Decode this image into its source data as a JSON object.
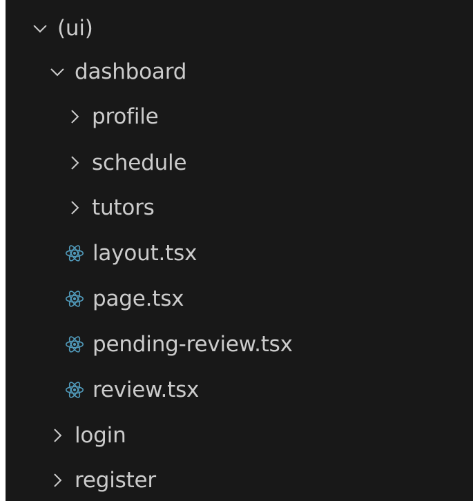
{
  "colors": {
    "background": "#181818",
    "text": "#cccccc",
    "react_icon": "#519aba"
  },
  "tree": {
    "ui": {
      "label": "(ui)",
      "state": "expanded",
      "icon": "chevron-down"
    },
    "dashboard": {
      "label": "dashboard",
      "state": "expanded",
      "icon": "chevron-down"
    },
    "profile": {
      "label": "profile",
      "state": "collapsed",
      "icon": "chevron-right"
    },
    "schedule": {
      "label": "schedule",
      "state": "collapsed",
      "icon": "chevron-right"
    },
    "tutors": {
      "label": "tutors",
      "state": "collapsed",
      "icon": "chevron-right"
    },
    "layout": {
      "label": "layout.tsx",
      "icon": "react-icon"
    },
    "page": {
      "label": "page.tsx",
      "icon": "react-icon"
    },
    "pending_review": {
      "label": "pending-review.tsx",
      "icon": "react-icon"
    },
    "review": {
      "label": "review.tsx",
      "icon": "react-icon"
    },
    "login": {
      "label": "login",
      "state": "collapsed",
      "icon": "chevron-right"
    },
    "register": {
      "label": "register",
      "state": "collapsed",
      "icon": "chevron-right"
    }
  }
}
